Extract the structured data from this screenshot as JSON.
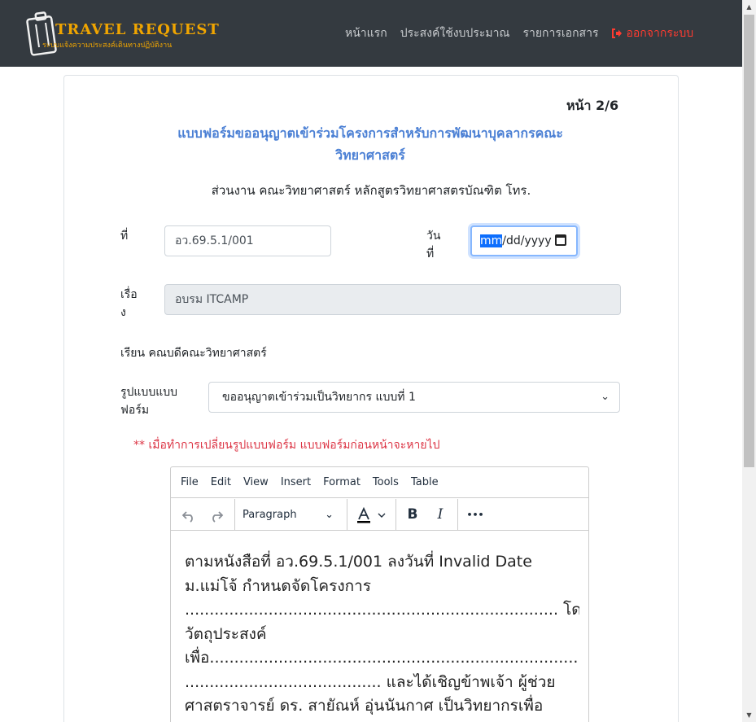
{
  "brand": {
    "title": "TRAVEL REQUEST",
    "subtitle": "ระบบแจ้งความประสงค์เดินทางปฏิบัติงาน"
  },
  "nav": {
    "home": "หน้าแรก",
    "budget": "ประสงค์ใช้งบประมาณ",
    "documents": "รายการเอกสาร",
    "logout": "ออกจากระบบ"
  },
  "page": {
    "number": "หน้า 2/6"
  },
  "form": {
    "title_line1": "แบบฟอร์มขออนุญาตเข้าร่วมโครงการสำหรับการพัฒนาบุคลากรคณะ",
    "title_line2": "วิทยาศาสตร์",
    "department": "ส่วนงาน คณะวิทยาศาสตร์ หลักสูตรวิทยาศาสตรบัณฑิต โทร.",
    "ref_label": "ที่",
    "ref_value": "อว.69.5.1/001",
    "date_label_1": "วัน",
    "date_label_2": "ที่",
    "date_selected": "mm",
    "date_rest": "/dd/yyyy",
    "subject_label_1": "เรื่อ",
    "subject_label_2": "ง",
    "subject_value": "อบรม  ITCAMP",
    "to_text": "เรียน คณบดีคณะวิทยาศาสตร์",
    "form_type_label_1": "รูปแบบแบบ",
    "form_type_label_2": "ฟอร์ม",
    "form_type_value": "ขออนุญาตเข้าร่วมเป็นวิทยากร แบบที่ 1",
    "warning": "** เมื่อทำการเปลี่ยนรูปแบบฟอร์ม แบบฟอร์มก่อนหน้าจะหายไป"
  },
  "editor": {
    "menu": [
      "File",
      "Edit",
      "View",
      "Insert",
      "Format",
      "Tools",
      "Table"
    ],
    "block_format": "Paragraph",
    "bold": "B",
    "italic": "I",
    "more": "•••",
    "lines": [
      "    ตามหนังสือที่ อว.69.5.1/001 ลงวันที่ Invalid Date",
      "ม.แม่โจ้ กำหนดจัดโครงการ",
      "............................................................................ โดยมี",
      "วัตถุประสงค์",
      "เพื่อ.................................................................................",
      "........................................ และได้เชิญข้าพเจ้า ผู้ช่วย",
      "ศาสตราจารย์ ดร. สายัณห์ อุ่นนันกาศ เป็นวิทยากรเพื่อ"
    ]
  },
  "colors": {
    "navbar": "#343a40",
    "brand": "#f0a500",
    "title": "#4a7fd4",
    "warning": "#dc3545",
    "logout": "#ff3b30"
  }
}
